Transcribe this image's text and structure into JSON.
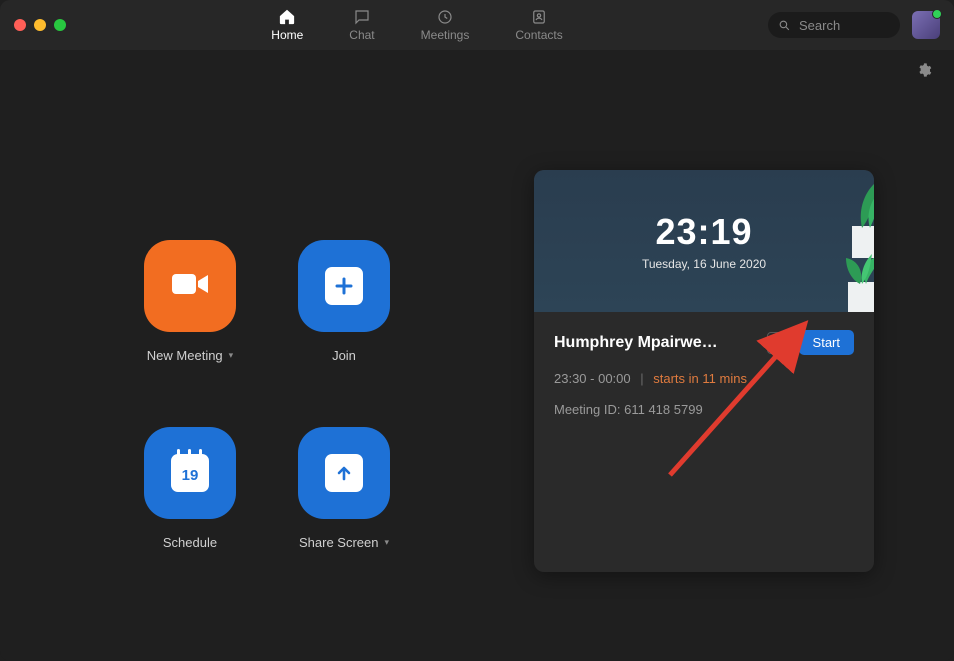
{
  "nav": {
    "home": {
      "label": "Home",
      "active": true
    },
    "chat": {
      "label": "Chat",
      "active": false
    },
    "meetings": {
      "label": "Meetings",
      "active": false
    },
    "contacts": {
      "label": "Contacts",
      "active": false
    }
  },
  "search": {
    "placeholder": "Search"
  },
  "actions": {
    "new_meeting": {
      "label": "New Meeting"
    },
    "join": {
      "label": "Join"
    },
    "schedule": {
      "label": "Schedule",
      "day": "19"
    },
    "share_screen": {
      "label": "Share Screen"
    }
  },
  "clock": {
    "time": "23:19",
    "date": "Tuesday, 16 June 2020"
  },
  "meeting": {
    "title": "Humphrey Mpairwe…",
    "time_range": "23:30 - 00:00",
    "countdown": "starts in 11 mins",
    "meeting_id_label": "Meeting ID:",
    "meeting_id": "611 418 5799",
    "start_label": "Start",
    "more_label": "···"
  },
  "colors": {
    "accent_blue": "#1e71d6",
    "accent_orange": "#f26d21",
    "countdown": "#e07b3f"
  }
}
